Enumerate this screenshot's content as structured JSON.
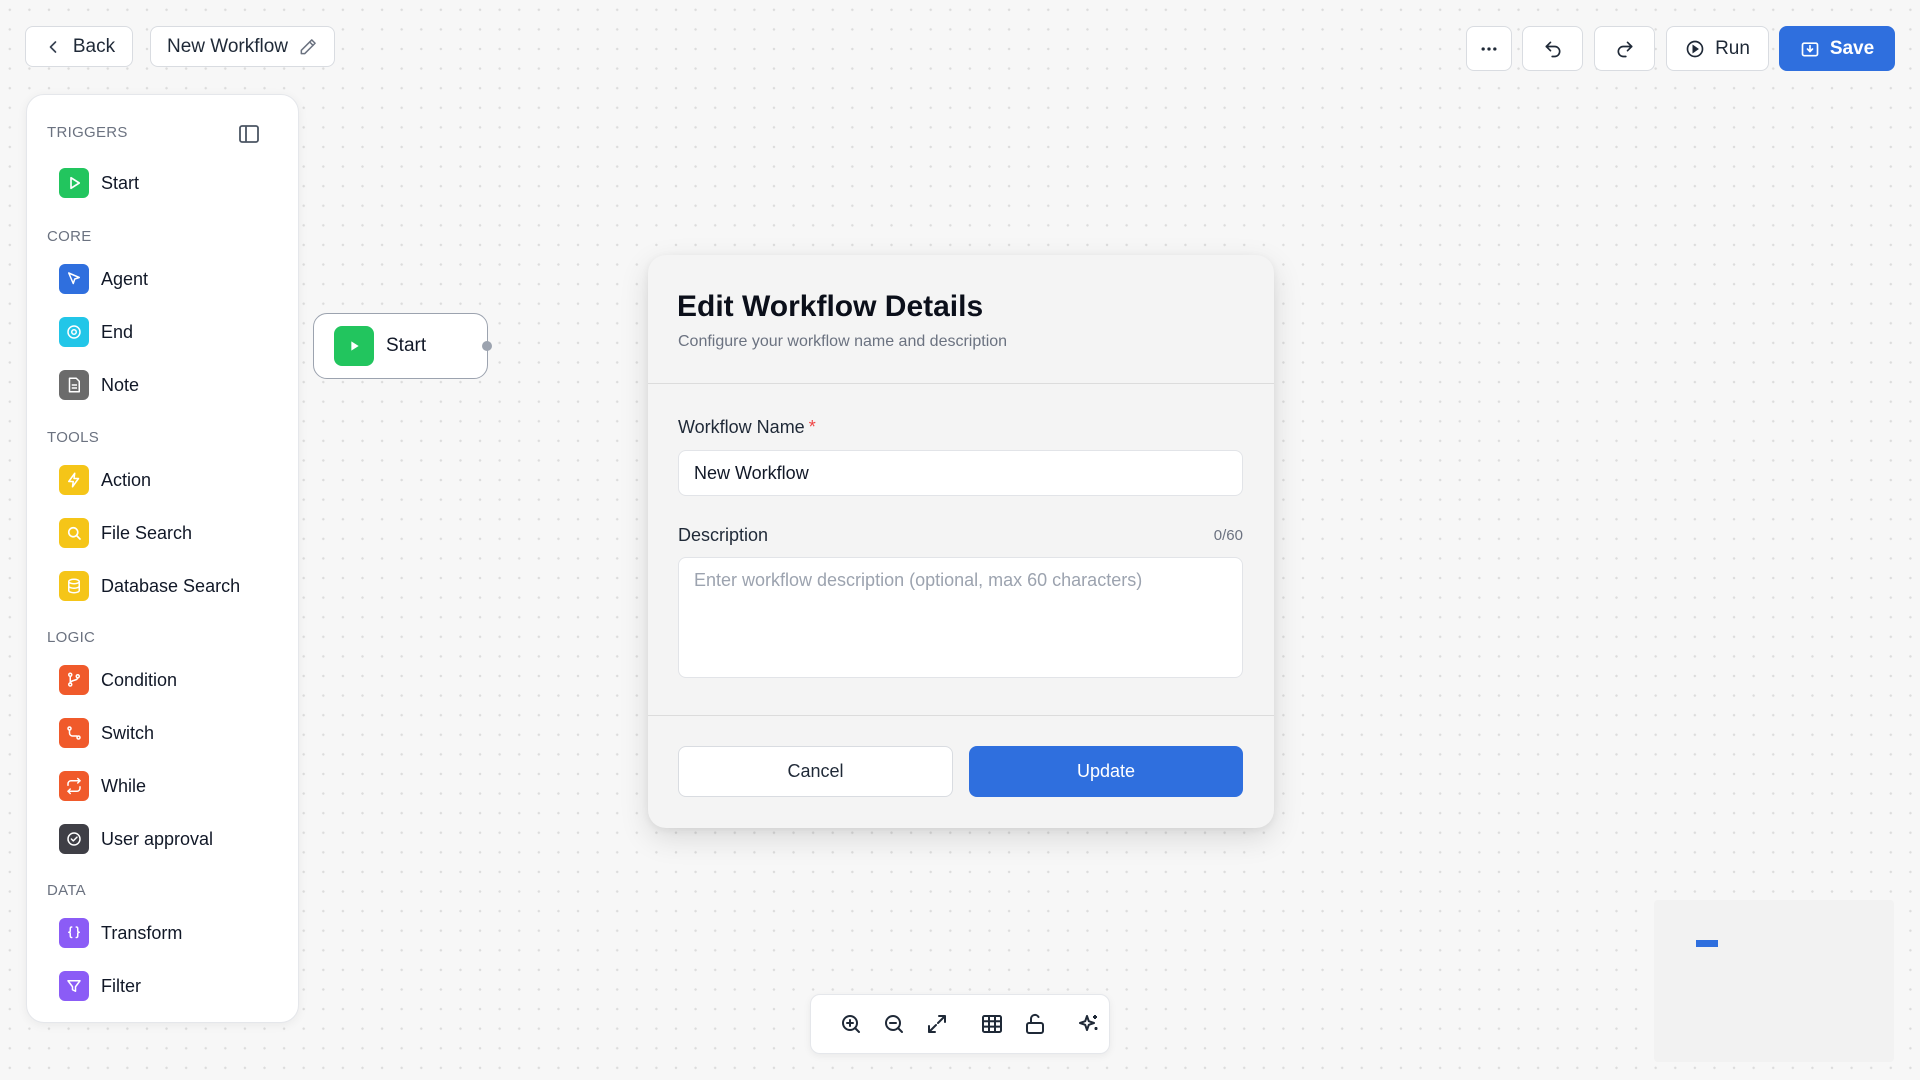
{
  "header": {
    "back_label": "Back",
    "workflow_title": "New Workflow",
    "run_label": "Run",
    "save_label": "Save"
  },
  "sidebar": {
    "sections": [
      {
        "title": "TRIGGERS",
        "items": [
          {
            "label": "Start",
            "icon": "play-icon",
            "color": "#22c55e"
          }
        ]
      },
      {
        "title": "CORE",
        "items": [
          {
            "label": "Agent",
            "icon": "cursor-icon",
            "color": "#2f6fde"
          },
          {
            "label": "End",
            "icon": "target-icon",
            "color": "#22c6e8"
          },
          {
            "label": "Note",
            "icon": "document-icon",
            "color": "#6b6b6b"
          }
        ]
      },
      {
        "title": "TOOLS",
        "items": [
          {
            "label": "Action",
            "icon": "bolt-icon",
            "color": "#f5c518"
          },
          {
            "label": "File Search",
            "icon": "search-icon",
            "color": "#f5c518"
          },
          {
            "label": "Database Search",
            "icon": "database-icon",
            "color": "#f5c518"
          }
        ]
      },
      {
        "title": "LOGIC",
        "items": [
          {
            "label": "Condition",
            "icon": "branch-icon",
            "color": "#f05a2b"
          },
          {
            "label": "Switch",
            "icon": "route-icon",
            "color": "#f05a2b"
          },
          {
            "label": "While",
            "icon": "repeat-icon",
            "color": "#f05a2b"
          },
          {
            "label": "User approval",
            "icon": "check-circle-icon",
            "color": "#3f3f46"
          }
        ]
      },
      {
        "title": "DATA",
        "items": [
          {
            "label": "Transform",
            "icon": "braces-icon",
            "color": "#8b5cf6"
          },
          {
            "label": "Filter",
            "icon": "funnel-icon",
            "color": "#8b5cf6"
          }
        ]
      }
    ]
  },
  "canvas": {
    "start_node_label": "Start"
  },
  "modal": {
    "title": "Edit Workflow Details",
    "subtitle": "Configure your workflow name and description",
    "name_label": "Workflow Name",
    "name_required_mark": "*",
    "name_value": "New Workflow",
    "description_label": "Description",
    "description_count": "0/60",
    "description_placeholder": "Enter workflow description (optional, max 60 characters)",
    "cancel_label": "Cancel",
    "update_label": "Update"
  },
  "colors": {
    "primary": "#2f6fde",
    "required": "#ef4444"
  }
}
